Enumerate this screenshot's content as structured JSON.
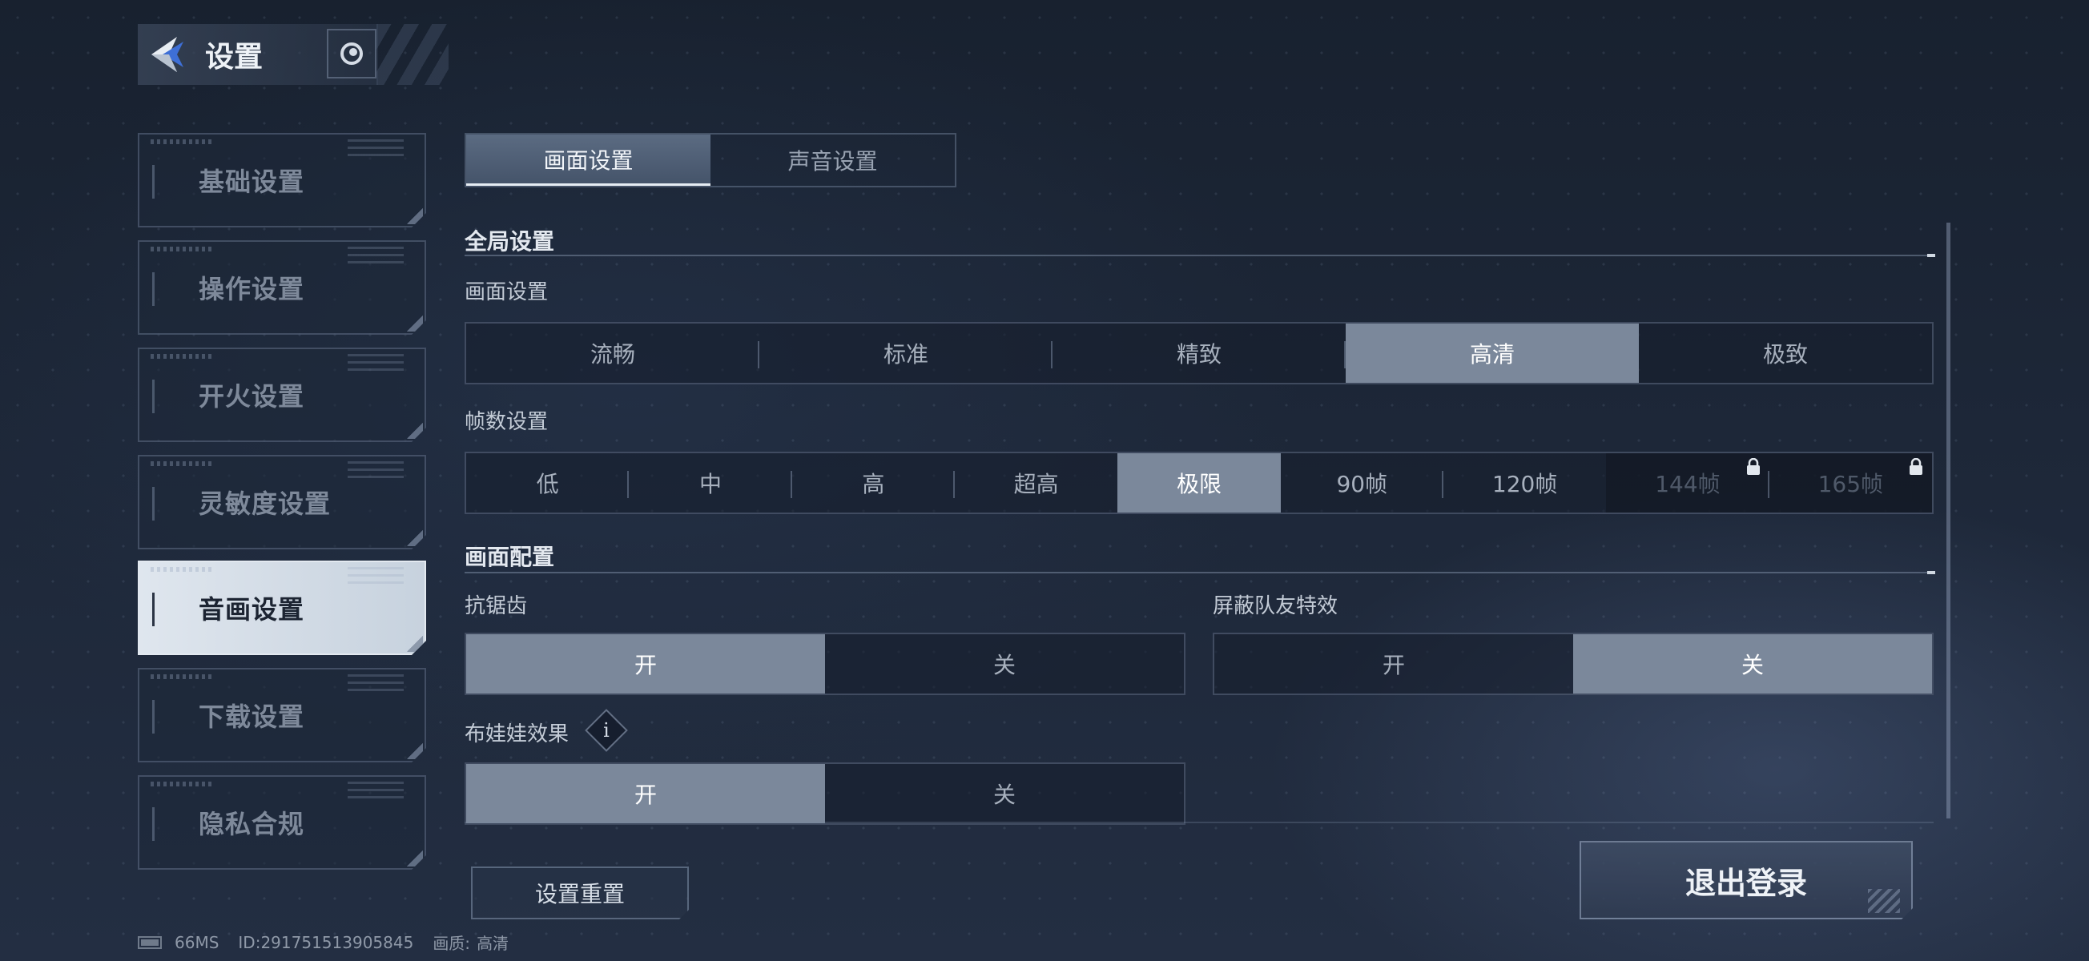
{
  "header": {
    "title": "设置"
  },
  "sidebar": {
    "items": [
      {
        "label": "基础设置",
        "active": false
      },
      {
        "label": "操作设置",
        "active": false
      },
      {
        "label": "开火设置",
        "active": false
      },
      {
        "label": "灵敏度设置",
        "active": false
      },
      {
        "label": "音画设置",
        "active": true
      },
      {
        "label": "下载设置",
        "active": false
      },
      {
        "label": "隐私合规",
        "active": false
      }
    ]
  },
  "tabs": [
    {
      "label": "画面设置",
      "active": true
    },
    {
      "label": "声音设置",
      "active": false
    }
  ],
  "global": {
    "title": "全局设置",
    "quality": {
      "label": "画面设置",
      "options": [
        "流畅",
        "标准",
        "精致",
        "高清",
        "极致"
      ],
      "selected": "高清"
    },
    "framerate": {
      "label": "帧数设置",
      "options": [
        "低",
        "中",
        "高",
        "超高",
        "极限",
        "90帧",
        "120帧",
        "144帧",
        "165帧"
      ],
      "selected": "极限",
      "locked": [
        "144帧",
        "165帧"
      ]
    }
  },
  "config": {
    "title": "画面配置",
    "antialias": {
      "label": "抗锯齿",
      "on": "开",
      "off": "关",
      "value": "开"
    },
    "hide_teammate_fx": {
      "label": "屏蔽队友特效",
      "on": "开",
      "off": "关",
      "value": "关"
    },
    "ragdoll": {
      "label": "布娃娃效果",
      "on": "开",
      "off": "关",
      "value": "开"
    }
  },
  "buttons": {
    "reset": "设置重置",
    "logout": "退出登录"
  },
  "footer": {
    "ping": "66MS",
    "id": "ID:291751513905845",
    "quality_label": "画质:",
    "quality_value": "高清"
  },
  "colors": {
    "selected": "#7b889b",
    "active_sidebar": "#dfe6ee",
    "background": "#1d2738"
  }
}
